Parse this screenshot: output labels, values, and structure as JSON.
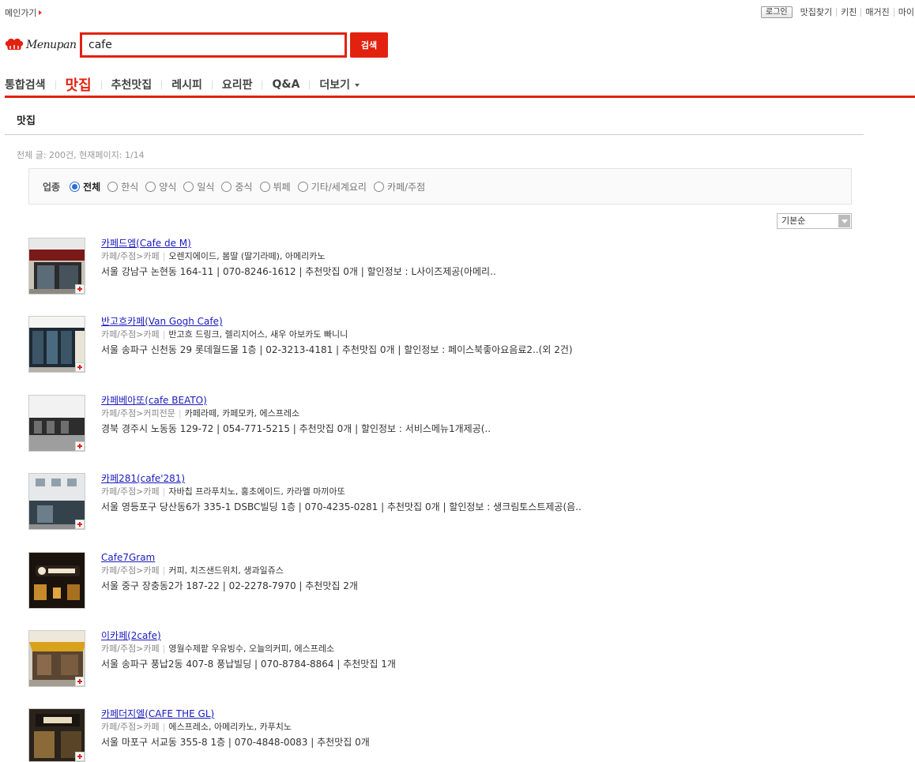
{
  "top": {
    "main_link": "메인가기",
    "login": "로그인",
    "util_links": [
      "맛집찾기",
      "키친",
      "매거진",
      "마이"
    ]
  },
  "logo": {
    "text": "Menupan"
  },
  "search": {
    "value": "cafe",
    "button": "검색"
  },
  "nav": {
    "tabs": [
      "통합검색",
      "맛집",
      "추천맛집",
      "레시피",
      "요리판",
      "Q&A",
      "더보기"
    ],
    "active": "맛집"
  },
  "section": {
    "title": "맛집",
    "summary": "전체 글: 200건, 현재페이지: 1/14"
  },
  "filter": {
    "label": "업종",
    "options": [
      "전체",
      "한식",
      "양식",
      "일식",
      "중식",
      "뷔페",
      "기타/세계요리",
      "카페/주점"
    ],
    "selected": "전체"
  },
  "sort": {
    "value": "기본순"
  },
  "results": [
    {
      "name": "카페드엠(Cafe de M)",
      "category": "카페/주점>카페",
      "menus": "오렌지에이드, 봄딸 (딸기라떼), 아메리카노",
      "address": "서울 강남구 논현동 164-11 | 070-8246-1612 | 추천맛집 0개 | 할인정보 : L사이즈제공(아메리.."
    },
    {
      "name": "반고흐카페(Van Gogh Cafe)",
      "category": "카페/주점>카페",
      "menus": "반고흐 드링크, 렐리지어스, 새우 아보카도 빠니니",
      "address": "서울 송파구 신천동 29 롯데월드몰 1층 | 02-3213-4181 | 추천맛집 0개 | 할인정보 : 페이스북좋아요음료2..(외 2건)"
    },
    {
      "name": "카페베아또(cafe BEATO)",
      "category": "카페/주점>커피전문",
      "menus": "카페라떼, 카페모카, 에스프레소",
      "address": "경북 경주시 노동동 129-72 | 054-771-5215 | 추천맛집 0개 | 할인정보 : 서비스메뉴1개제공(.."
    },
    {
      "name": "카페281(cafe'281)",
      "category": "카페/주점>카페",
      "menus": "자바칩 프라푸치노, 홍초에이드, 카라멜 마끼아또",
      "address": "서울 영등포구 당산동6가 335-1 DSBC빌딩 1층 | 070-4235-0281 | 추천맛집 0개 | 할인정보 : 생크림토스트제공(음.."
    },
    {
      "name": "Cafe7Gram",
      "category": "카페/주점>카페",
      "menus": "커피, 치즈샌드위치, 생과일쥬스",
      "address": "서울 중구 장충동2가 187-22 | 02-2278-7970 | 추천맛집 2개"
    },
    {
      "name": "이카페(2cafe)",
      "category": "카페/주점>카페",
      "menus": "영월수제팥 우유빙수, 오늘의커피, 에스프레소",
      "address": "서울 송파구 풍납2동 407-8 풍납빌딩 | 070-8784-8864 | 추천맛집 1개"
    },
    {
      "name": "카페더지엘(CAFE THE GL)",
      "category": "카페/주점>카페",
      "menus": "에스프레소, 아메리카노, 카푸치노",
      "address": "서울 마포구 서교동 355-8 1층 | 070-4848-0083 | 추천맛집 0개"
    }
  ],
  "thumb_icon": "plus-icon"
}
